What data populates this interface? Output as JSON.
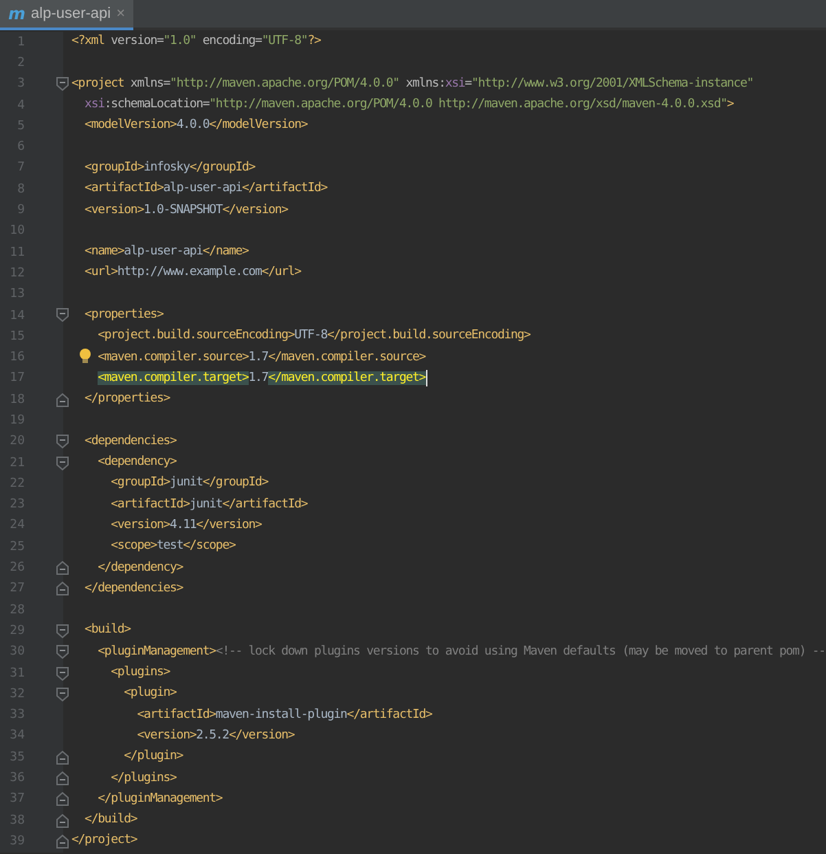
{
  "tab": {
    "icon_letter": "m",
    "title": "alp-user-api",
    "close": "×",
    "selected": true
  },
  "lines": [
    {
      "n": "1",
      "caret": false,
      "bulb": false,
      "segs": [
        {
          "kind": "tag",
          "text": "<?xml "
        },
        {
          "kind": "attr",
          "text": "version="
        },
        {
          "kind": "value",
          "text": "\"1.0\""
        },
        {
          "kind": "attr",
          "text": " encoding="
        },
        {
          "kind": "value",
          "text": "\"UTF-8\""
        },
        {
          "kind": "tag",
          "text": "?>"
        }
      ]
    },
    {
      "n": "2",
      "caret": false,
      "bulb": false
    },
    {
      "n": "3",
      "kind": "fold_start",
      "caret": false,
      "bulb": false,
      "segs": [
        {
          "kind": "tag",
          "text": "<project "
        },
        {
          "kind": "attr",
          "text": "xmlns="
        },
        {
          "kind": "value",
          "text": "\"http://maven.apache.org/POM/4.0.0\""
        },
        {
          "kind": "attr",
          "text": " xmlns:"
        },
        {
          "kind": "ns",
          "text": "xsi"
        },
        {
          "kind": "attr",
          "text": "="
        },
        {
          "kind": "value",
          "text": "\"http://www.w3.org/2001/XMLSchema-instance\""
        }
      ]
    },
    {
      "n": "4",
      "caret": false,
      "bulb": false,
      "segs": [
        {
          "kind": "ns",
          "text": "  xsi"
        },
        {
          "kind": "attr",
          "text": ":schemaLocation="
        },
        {
          "kind": "value",
          "text": "\"http://maven.apache.org/POM/4.0.0 http://maven.apache.org/xsd/maven-4.0.0.xsd\""
        },
        {
          "kind": "tag",
          "text": ">"
        }
      ]
    },
    {
      "n": "5",
      "caret": false,
      "bulb": false,
      "segs": [
        {
          "kind": "tag",
          "text": "  <modelVersion>"
        },
        {
          "kind": "text",
          "text": "4.0.0"
        },
        {
          "kind": "tag",
          "text": "</modelVersion>"
        }
      ]
    },
    {
      "n": "6",
      "caret": false,
      "bulb": false
    },
    {
      "n": "7",
      "caret": false,
      "bulb": false,
      "segs": [
        {
          "kind": "tag",
          "text": "  <groupId>"
        },
        {
          "kind": "text",
          "text": "infosky"
        },
        {
          "kind": "tag",
          "text": "</groupId>"
        }
      ]
    },
    {
      "n": "8",
      "caret": false,
      "bulb": false,
      "segs": [
        {
          "kind": "tag",
          "text": "  <artifactId>"
        },
        {
          "kind": "text",
          "text": "alp-user-api"
        },
        {
          "kind": "tag",
          "text": "</artifactId>"
        }
      ]
    },
    {
      "n": "9",
      "caret": false,
      "bulb": false,
      "segs": [
        {
          "kind": "tag",
          "text": "  <version>"
        },
        {
          "kind": "text",
          "text": "1.0-SNAPSHOT"
        },
        {
          "kind": "tag",
          "text": "</version>"
        }
      ]
    },
    {
      "n": "10",
      "caret": false,
      "bulb": false
    },
    {
      "n": "11",
      "caret": false,
      "bulb": false,
      "segs": [
        {
          "kind": "tag",
          "text": "  <name>"
        },
        {
          "kind": "text",
          "text": "alp-user-api"
        },
        {
          "kind": "tag",
          "text": "</name>"
        }
      ]
    },
    {
      "n": "12",
      "caret": false,
      "bulb": false,
      "segs": [
        {
          "kind": "tag",
          "text": "  <url>"
        },
        {
          "kind": "text",
          "text": "http://www.example.com"
        },
        {
          "kind": "tag",
          "text": "</url>"
        }
      ]
    },
    {
      "n": "13",
      "caret": false,
      "bulb": false
    },
    {
      "n": "14",
      "kind": "fold_start",
      "caret": false,
      "bulb": false,
      "segs": [
        {
          "kind": "tag",
          "text": "  <properties>"
        }
      ]
    },
    {
      "n": "15",
      "caret": false,
      "bulb": false,
      "segs": [
        {
          "kind": "tag",
          "text": "    <project.build.sourceEncoding>"
        },
        {
          "kind": "text",
          "text": "UTF-8"
        },
        {
          "kind": "tag",
          "text": "</project.build.sourceEncoding>"
        }
      ]
    },
    {
      "n": "16",
      "caret": false,
      "bulb": true,
      "segs": [
        {
          "kind": "tag",
          "text": "    <maven.compiler.source>"
        },
        {
          "kind": "text",
          "text": "1.7"
        },
        {
          "kind": "tag",
          "text": "</maven.compiler.source>"
        }
      ]
    },
    {
      "n": "17",
      "caret": true,
      "bulb": false,
      "segs": [
        {
          "kind": "tag",
          "text": "    <maven.compiler.target>"
        },
        {
          "kind": "text",
          "text": "1.7"
        },
        {
          "kind": "tag",
          "text": "</maven.compiler.target>"
        }
      ]
    },
    {
      "n": "18",
      "kind": "fold_end",
      "caret": false,
      "bulb": false,
      "segs": [
        {
          "kind": "tag",
          "text": "  </properties>"
        }
      ]
    },
    {
      "n": "19",
      "caret": false,
      "bulb": false
    },
    {
      "n": "20",
      "kind": "fold_start",
      "caret": false,
      "bulb": false,
      "segs": [
        {
          "kind": "tag",
          "text": "  <dependencies>"
        }
      ]
    },
    {
      "n": "21",
      "kind": "fold_start",
      "caret": false,
      "bulb": false,
      "segs": [
        {
          "kind": "tag",
          "text": "    <dependency>"
        }
      ]
    },
    {
      "n": "22",
      "caret": false,
      "bulb": false,
      "segs": [
        {
          "kind": "tag",
          "text": "      <groupId>"
        },
        {
          "kind": "text",
          "text": "junit"
        },
        {
          "kind": "tag",
          "text": "</groupId>"
        }
      ]
    },
    {
      "n": "23",
      "caret": false,
      "bulb": false,
      "segs": [
        {
          "kind": "tag",
          "text": "      <artifactId>"
        },
        {
          "kind": "text",
          "text": "junit"
        },
        {
          "kind": "tag",
          "text": "</artifactId>"
        }
      ]
    },
    {
      "n": "24",
      "caret": false,
      "bulb": false,
      "segs": [
        {
          "kind": "tag",
          "text": "      <version>"
        },
        {
          "kind": "text",
          "text": "4.11"
        },
        {
          "kind": "tag",
          "text": "</version>"
        }
      ]
    },
    {
      "n": "25",
      "caret": false,
      "bulb": false,
      "segs": [
        {
          "kind": "tag",
          "text": "      <scope>"
        },
        {
          "kind": "text",
          "text": "test"
        },
        {
          "kind": "tag",
          "text": "</scope>"
        }
      ]
    },
    {
      "n": "26",
      "kind": "fold_end",
      "caret": false,
      "bulb": false,
      "segs": [
        {
          "kind": "tag",
          "text": "    </dependency>"
        }
      ]
    },
    {
      "n": "27",
      "kind": "fold_end",
      "caret": false,
      "bulb": false,
      "segs": [
        {
          "kind": "tag",
          "text": "  </dependencies>"
        }
      ]
    },
    {
      "n": "28",
      "caret": false,
      "bulb": false
    },
    {
      "n": "29",
      "kind": "fold_start",
      "caret": false,
      "bulb": false,
      "segs": [
        {
          "kind": "tag",
          "text": "  <build>"
        }
      ]
    },
    {
      "n": "30",
      "kind": "fold_start",
      "caret": false,
      "bulb": false,
      "segs": [
        {
          "kind": "tag",
          "text": "    <pluginManagement>"
        },
        {
          "kind": "comment",
          "text": "<!-- lock down plugins versions to avoid using Maven defaults (may be moved to parent pom) --"
        }
      ]
    },
    {
      "n": "31",
      "kind": "fold_start",
      "caret": false,
      "bulb": false,
      "segs": [
        {
          "kind": "tag",
          "text": "      <plugins>"
        }
      ]
    },
    {
      "n": "32",
      "kind": "fold_start",
      "caret": false,
      "bulb": false,
      "segs": [
        {
          "kind": "tag",
          "text": "        <plugin>"
        }
      ]
    },
    {
      "n": "33",
      "caret": false,
      "bulb": false,
      "segs": [
        {
          "kind": "tag",
          "text": "          <artifactId>"
        },
        {
          "kind": "text",
          "text": "maven-install-plugin"
        },
        {
          "kind": "tag",
          "text": "</artifactId>"
        }
      ]
    },
    {
      "n": "34",
      "caret": false,
      "bulb": false,
      "segs": [
        {
          "kind": "tag",
          "text": "          <version>"
        },
        {
          "kind": "text",
          "text": "2.5.2"
        },
        {
          "kind": "tag",
          "text": "</version>"
        }
      ]
    },
    {
      "n": "35",
      "kind": "fold_end",
      "caret": false,
      "bulb": false,
      "segs": [
        {
          "kind": "tag",
          "text": "        </plugin>"
        }
      ]
    },
    {
      "n": "36",
      "kind": "fold_end",
      "caret": false,
      "bulb": false,
      "segs": [
        {
          "kind": "tag",
          "text": "      </plugins>"
        }
      ]
    },
    {
      "n": "37",
      "kind": "fold_end",
      "caret": false,
      "bulb": false,
      "segs": [
        {
          "kind": "tag",
          "text": "    </pluginManagement>"
        }
      ]
    },
    {
      "n": "38",
      "kind": "fold_end",
      "caret": false,
      "bulb": false,
      "segs": [
        {
          "kind": "tag",
          "text": "  </build>"
        }
      ]
    },
    {
      "n": "39",
      "kind": "fold_end",
      "caret": false,
      "bulb": false,
      "segs": [
        {
          "kind": "tag",
          "text": "</project>"
        }
      ]
    }
  ]
}
